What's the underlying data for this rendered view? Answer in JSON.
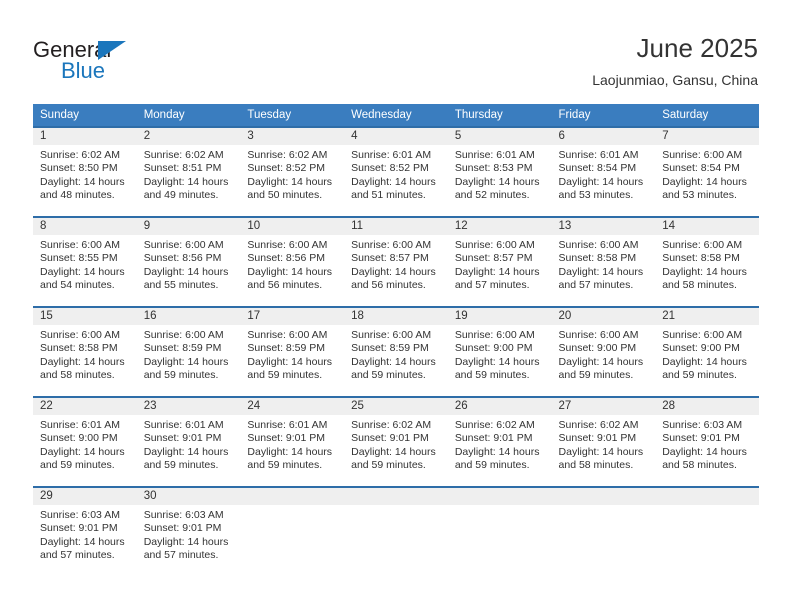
{
  "brand": {
    "name_top": "General",
    "name_bottom": "Blue",
    "triangle_color": "#1b76bc",
    "text_color": "#231f20"
  },
  "header": {
    "title": "June 2025",
    "location": "Laojunmiao, Gansu, China"
  },
  "colors": {
    "header_row_bg": "#3a7dbf",
    "header_row_text": "#ffffff",
    "week_separator": "#2e6da8",
    "daynum_band_bg": "#efefef",
    "body_text": "#333333",
    "page_bg": "#ffffff"
  },
  "weekday_headers": [
    "Sunday",
    "Monday",
    "Tuesday",
    "Wednesday",
    "Thursday",
    "Friday",
    "Saturday"
  ],
  "labels": {
    "sunrise_prefix": "Sunrise:",
    "sunset_prefix": "Sunset:",
    "daylight_prefix": "Daylight:"
  },
  "weeks": [
    [
      {
        "day": "1",
        "sunrise": "Sunrise: 6:02 AM",
        "sunset": "Sunset: 8:50 PM",
        "daylight_line1": "Daylight: 14 hours",
        "daylight_line2": "and 48 minutes."
      },
      {
        "day": "2",
        "sunrise": "Sunrise: 6:02 AM",
        "sunset": "Sunset: 8:51 PM",
        "daylight_line1": "Daylight: 14 hours",
        "daylight_line2": "and 49 minutes."
      },
      {
        "day": "3",
        "sunrise": "Sunrise: 6:02 AM",
        "sunset": "Sunset: 8:52 PM",
        "daylight_line1": "Daylight: 14 hours",
        "daylight_line2": "and 50 minutes."
      },
      {
        "day": "4",
        "sunrise": "Sunrise: 6:01 AM",
        "sunset": "Sunset: 8:52 PM",
        "daylight_line1": "Daylight: 14 hours",
        "daylight_line2": "and 51 minutes."
      },
      {
        "day": "5",
        "sunrise": "Sunrise: 6:01 AM",
        "sunset": "Sunset: 8:53 PM",
        "daylight_line1": "Daylight: 14 hours",
        "daylight_line2": "and 52 minutes."
      },
      {
        "day": "6",
        "sunrise": "Sunrise: 6:01 AM",
        "sunset": "Sunset: 8:54 PM",
        "daylight_line1": "Daylight: 14 hours",
        "daylight_line2": "and 53 minutes."
      },
      {
        "day": "7",
        "sunrise": "Sunrise: 6:00 AM",
        "sunset": "Sunset: 8:54 PM",
        "daylight_line1": "Daylight: 14 hours",
        "daylight_line2": "and 53 minutes."
      }
    ],
    [
      {
        "day": "8",
        "sunrise": "Sunrise: 6:00 AM",
        "sunset": "Sunset: 8:55 PM",
        "daylight_line1": "Daylight: 14 hours",
        "daylight_line2": "and 54 minutes."
      },
      {
        "day": "9",
        "sunrise": "Sunrise: 6:00 AM",
        "sunset": "Sunset: 8:56 PM",
        "daylight_line1": "Daylight: 14 hours",
        "daylight_line2": "and 55 minutes."
      },
      {
        "day": "10",
        "sunrise": "Sunrise: 6:00 AM",
        "sunset": "Sunset: 8:56 PM",
        "daylight_line1": "Daylight: 14 hours",
        "daylight_line2": "and 56 minutes."
      },
      {
        "day": "11",
        "sunrise": "Sunrise: 6:00 AM",
        "sunset": "Sunset: 8:57 PM",
        "daylight_line1": "Daylight: 14 hours",
        "daylight_line2": "and 56 minutes."
      },
      {
        "day": "12",
        "sunrise": "Sunrise: 6:00 AM",
        "sunset": "Sunset: 8:57 PM",
        "daylight_line1": "Daylight: 14 hours",
        "daylight_line2": "and 57 minutes."
      },
      {
        "day": "13",
        "sunrise": "Sunrise: 6:00 AM",
        "sunset": "Sunset: 8:58 PM",
        "daylight_line1": "Daylight: 14 hours",
        "daylight_line2": "and 57 minutes."
      },
      {
        "day": "14",
        "sunrise": "Sunrise: 6:00 AM",
        "sunset": "Sunset: 8:58 PM",
        "daylight_line1": "Daylight: 14 hours",
        "daylight_line2": "and 58 minutes."
      }
    ],
    [
      {
        "day": "15",
        "sunrise": "Sunrise: 6:00 AM",
        "sunset": "Sunset: 8:58 PM",
        "daylight_line1": "Daylight: 14 hours",
        "daylight_line2": "and 58 minutes."
      },
      {
        "day": "16",
        "sunrise": "Sunrise: 6:00 AM",
        "sunset": "Sunset: 8:59 PM",
        "daylight_line1": "Daylight: 14 hours",
        "daylight_line2": "and 59 minutes."
      },
      {
        "day": "17",
        "sunrise": "Sunrise: 6:00 AM",
        "sunset": "Sunset: 8:59 PM",
        "daylight_line1": "Daylight: 14 hours",
        "daylight_line2": "and 59 minutes."
      },
      {
        "day": "18",
        "sunrise": "Sunrise: 6:00 AM",
        "sunset": "Sunset: 8:59 PM",
        "daylight_line1": "Daylight: 14 hours",
        "daylight_line2": "and 59 minutes."
      },
      {
        "day": "19",
        "sunrise": "Sunrise: 6:00 AM",
        "sunset": "Sunset: 9:00 PM",
        "daylight_line1": "Daylight: 14 hours",
        "daylight_line2": "and 59 minutes."
      },
      {
        "day": "20",
        "sunrise": "Sunrise: 6:00 AM",
        "sunset": "Sunset: 9:00 PM",
        "daylight_line1": "Daylight: 14 hours",
        "daylight_line2": "and 59 minutes."
      },
      {
        "day": "21",
        "sunrise": "Sunrise: 6:00 AM",
        "sunset": "Sunset: 9:00 PM",
        "daylight_line1": "Daylight: 14 hours",
        "daylight_line2": "and 59 minutes."
      }
    ],
    [
      {
        "day": "22",
        "sunrise": "Sunrise: 6:01 AM",
        "sunset": "Sunset: 9:00 PM",
        "daylight_line1": "Daylight: 14 hours",
        "daylight_line2": "and 59 minutes."
      },
      {
        "day": "23",
        "sunrise": "Sunrise: 6:01 AM",
        "sunset": "Sunset: 9:01 PM",
        "daylight_line1": "Daylight: 14 hours",
        "daylight_line2": "and 59 minutes."
      },
      {
        "day": "24",
        "sunrise": "Sunrise: 6:01 AM",
        "sunset": "Sunset: 9:01 PM",
        "daylight_line1": "Daylight: 14 hours",
        "daylight_line2": "and 59 minutes."
      },
      {
        "day": "25",
        "sunrise": "Sunrise: 6:02 AM",
        "sunset": "Sunset: 9:01 PM",
        "daylight_line1": "Daylight: 14 hours",
        "daylight_line2": "and 59 minutes."
      },
      {
        "day": "26",
        "sunrise": "Sunrise: 6:02 AM",
        "sunset": "Sunset: 9:01 PM",
        "daylight_line1": "Daylight: 14 hours",
        "daylight_line2": "and 59 minutes."
      },
      {
        "day": "27",
        "sunrise": "Sunrise: 6:02 AM",
        "sunset": "Sunset: 9:01 PM",
        "daylight_line1": "Daylight: 14 hours",
        "daylight_line2": "and 58 minutes."
      },
      {
        "day": "28",
        "sunrise": "Sunrise: 6:03 AM",
        "sunset": "Sunset: 9:01 PM",
        "daylight_line1": "Daylight: 14 hours",
        "daylight_line2": "and 58 minutes."
      }
    ],
    [
      {
        "day": "29",
        "sunrise": "Sunrise: 6:03 AM",
        "sunset": "Sunset: 9:01 PM",
        "daylight_line1": "Daylight: 14 hours",
        "daylight_line2": "and 57 minutes."
      },
      {
        "day": "30",
        "sunrise": "Sunrise: 6:03 AM",
        "sunset": "Sunset: 9:01 PM",
        "daylight_line1": "Daylight: 14 hours",
        "daylight_line2": "and 57 minutes."
      },
      {
        "day": "",
        "sunrise": "",
        "sunset": "",
        "daylight_line1": "",
        "daylight_line2": ""
      },
      {
        "day": "",
        "sunrise": "",
        "sunset": "",
        "daylight_line1": "",
        "daylight_line2": ""
      },
      {
        "day": "",
        "sunrise": "",
        "sunset": "",
        "daylight_line1": "",
        "daylight_line2": ""
      },
      {
        "day": "",
        "sunrise": "",
        "sunset": "",
        "daylight_line1": "",
        "daylight_line2": ""
      },
      {
        "day": "",
        "sunrise": "",
        "sunset": "",
        "daylight_line1": "",
        "daylight_line2": ""
      }
    ]
  ]
}
